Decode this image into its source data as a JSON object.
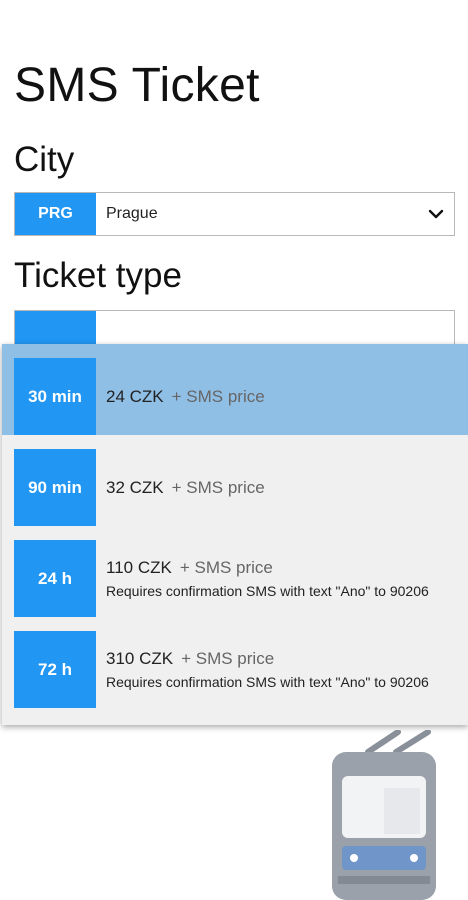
{
  "app_title": "SMS Ticket",
  "city": {
    "label": "City",
    "code": "PRG",
    "value": "Prague"
  },
  "ticket_type": {
    "label": "Ticket type"
  },
  "dropdown": {
    "options": [
      {
        "duration": "30 min",
        "price": "24 CZK",
        "extra": "+ SMS price",
        "note": "",
        "selected": true
      },
      {
        "duration": "90 min",
        "price": "32 CZK",
        "extra": "+ SMS price",
        "note": "",
        "selected": false
      },
      {
        "duration": "24 h",
        "price": "110 CZK",
        "extra": "+ SMS price",
        "note": "Requires confirmation SMS with text \"Ano\" to 90206",
        "selected": false
      },
      {
        "duration": "72 h",
        "price": "310 CZK",
        "extra": "+ SMS price",
        "note": "Requires confirmation SMS with text \"Ano\" to 90206",
        "selected": false
      }
    ]
  },
  "colors": {
    "accent": "#2196F3",
    "selected_row": "#90bfe6",
    "popup_bg": "#f0f0f0"
  },
  "icons": {
    "dropdown": "chevron-down-icon",
    "illustration": "trolleybus-icon"
  }
}
